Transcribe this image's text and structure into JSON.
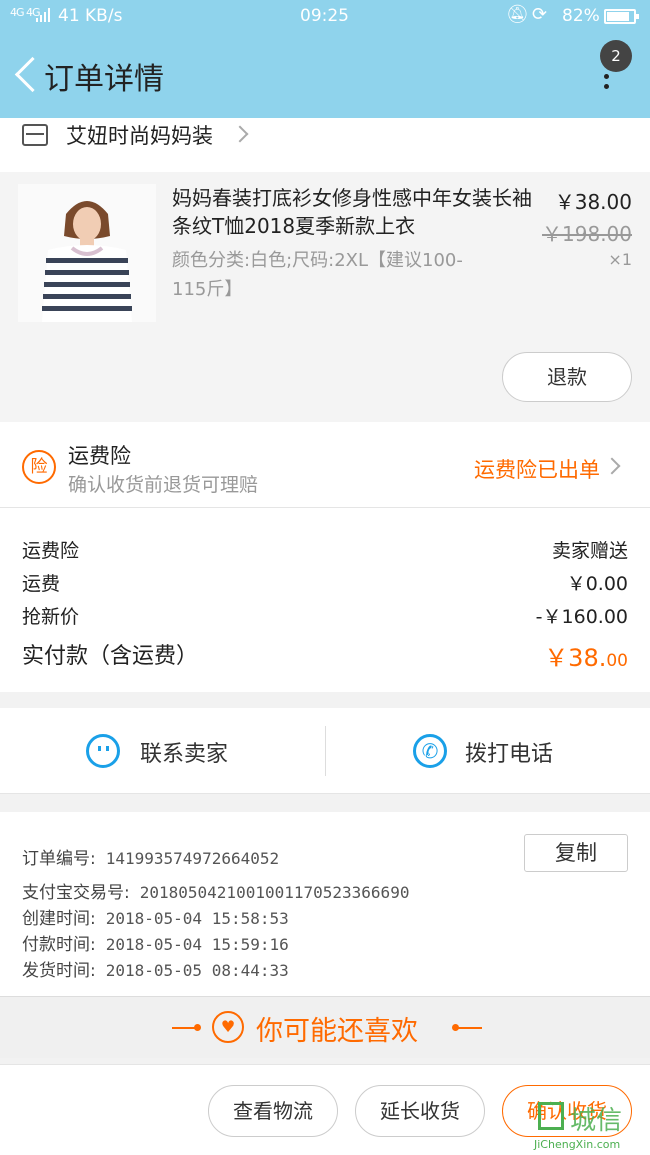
{
  "status_bar": {
    "signal": "4G 4G",
    "speed": "41 KB/s",
    "time": "09:25",
    "battery": "82%"
  },
  "header": {
    "title": "订单详情",
    "badge_count": "2"
  },
  "shop": {
    "name": "艾妞时尚妈妈装"
  },
  "product": {
    "title": "妈妈春装打底衫女修身性感中年女装长袖条纹T恤2018夏季新款上衣",
    "spec": "颜色分类:白色;尺码:2XL【建议100-115斤】",
    "price": "￥38.00",
    "original_price": "￥198.00",
    "quantity": "×1",
    "refund_label": "退款"
  },
  "insurance": {
    "icon_text": "险",
    "title": "运费险",
    "subtitle": "确认收货前退货可理赔",
    "status": "运费险已出单"
  },
  "fees": [
    {
      "label": "运费险",
      "value": "卖家赠送"
    },
    {
      "label": "运费",
      "value": "￥0.00"
    },
    {
      "label": "抢新价",
      "value": "-￥160.00"
    }
  ],
  "total": {
    "label": "实付款（含运费）",
    "value_main": "￥38.",
    "value_cents": "00"
  },
  "contact": {
    "seller_label": "联系卖家",
    "call_label": "拨打电话"
  },
  "order_info": {
    "copy_label": "复制",
    "rows": [
      {
        "label": "订单编号:",
        "value": "141993574972664052"
      },
      {
        "label": "支付宝交易号:",
        "value": "2018050421001001170523366690"
      },
      {
        "label": "创建时间:",
        "value": "2018-05-04  15:58:53"
      },
      {
        "label": "付款时间:",
        "value": "2018-05-04  15:59:16"
      },
      {
        "label": "发货时间:",
        "value": "2018-05-05  08:44:33"
      }
    ]
  },
  "recommend": {
    "title": "你可能还喜欢"
  },
  "actions": {
    "logistics": "查看物流",
    "extend": "延长收货",
    "confirm": "确认收货"
  },
  "watermark": {
    "text": "城信",
    "url": "JiChengXin.com"
  },
  "colors": {
    "header": "#8fd3ec",
    "accent": "#ff6a00",
    "link_blue": "#1aa0e8"
  }
}
